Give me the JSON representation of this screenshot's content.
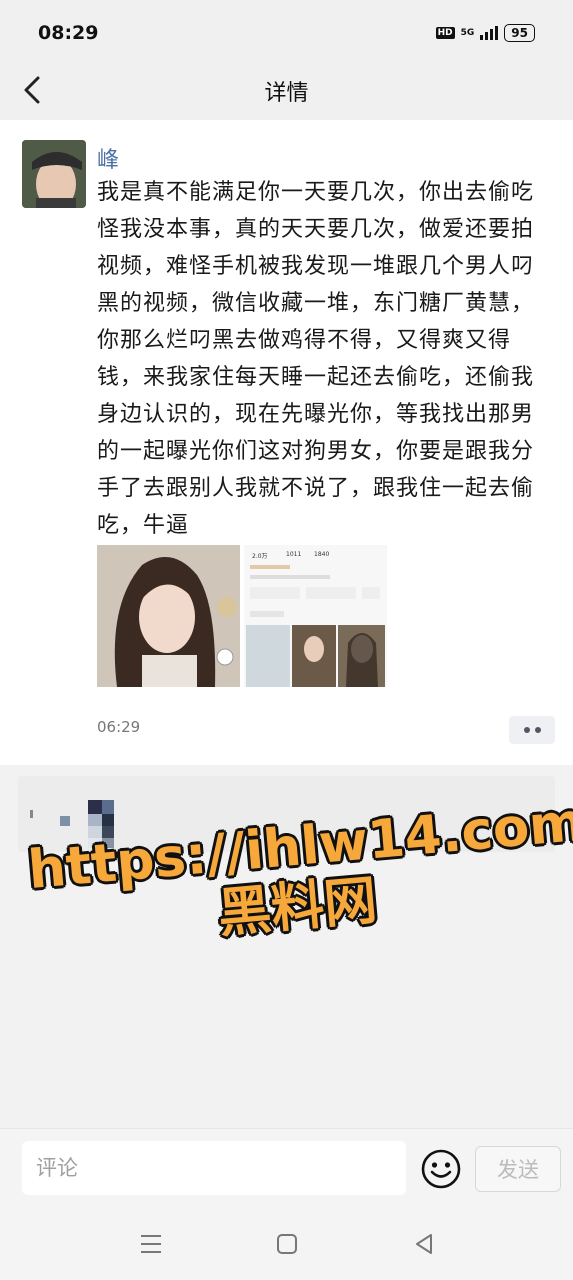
{
  "status_bar": {
    "time": "08:29",
    "hd": "HD",
    "network": "5G",
    "battery": "95"
  },
  "header": {
    "title": "详情"
  },
  "post": {
    "author": "峰",
    "text": "我是真不能满足你一天要几次，你出去偷吃怪我没本事，真的天天要几次，做爱还要拍视频，难怪手机被我发现一堆跟几个男人叼黑的视频，微信收藏一堆，东门糖厂黄慧，你那么烂叼黑去做鸡得不得，又得爽又得钱，来我家住每天睡一起还去偷吃，还偷我身边认识的，现在先曝光你，等我找出那男的一起曝光你们这对狗男女，你要是跟我分手了去跟别人我就不说了，跟我住一起去偷吃，牛逼",
    "timestamp": "06:29",
    "image2_stats": [
      "2.0万",
      "1011",
      "1840"
    ]
  },
  "watermark": {
    "line1": "https://ihlw14.com",
    "line2": "黑料网"
  },
  "comment_bar": {
    "placeholder": "评论",
    "send_label": "发送"
  },
  "icons": {
    "back": "back-chevron-icon",
    "emoji": "emoji-smile-icon",
    "more": "more-dots-icon",
    "menu": "menu-lines-icon",
    "home": "home-square-icon",
    "sys_back": "back-triangle-icon"
  }
}
